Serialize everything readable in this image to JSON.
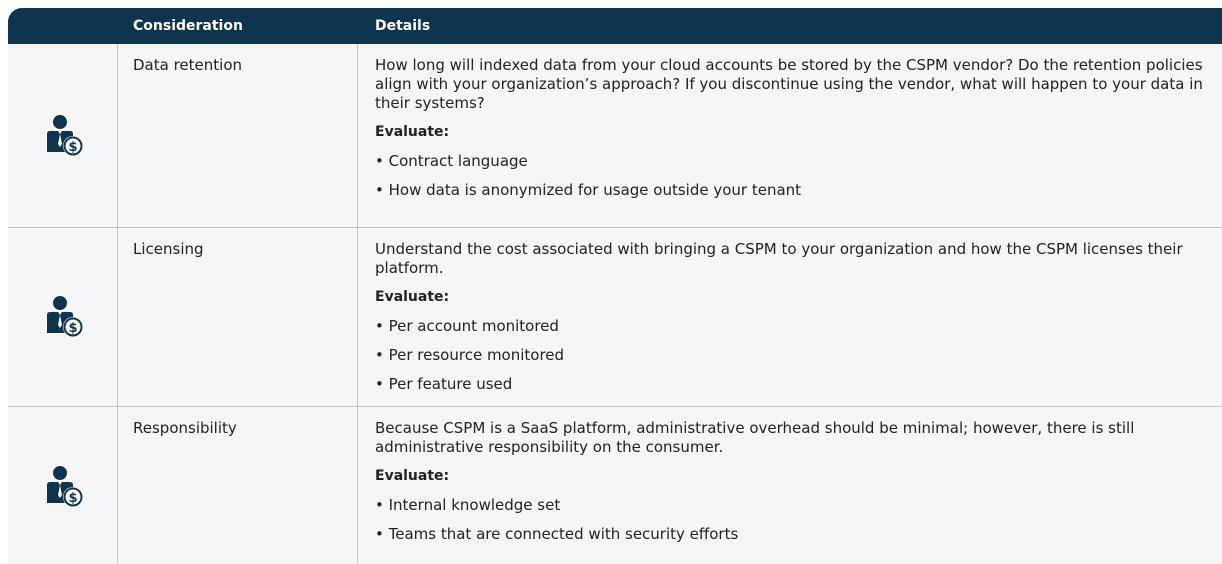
{
  "header": {
    "consideration": "Consideration",
    "details": "Details"
  },
  "rows": [
    {
      "consideration": "Data retention",
      "description": "How long will indexed data from your cloud accounts be stored by the CSPM vendor? Do the retention policies align with your organization’s approach? If you discontinue using the vendor, what will happen to your data in their systems?",
      "evaluate_label": "Evaluate:",
      "bullets": [
        "Contract language",
        "How data is anonymized for usage outside your tenant"
      ],
      "icon": "person-dollar-icon"
    },
    {
      "consideration": "Licensing",
      "description": "Understand the cost associated with bringing a CSPM to your organization and how the CSPM licenses their platform.",
      "evaluate_label": "Evaluate:",
      "bullets": [
        "Per account monitored",
        "Per resource monitored",
        "Per feature used"
      ],
      "icon": "person-dollar-icon"
    },
    {
      "consideration": "Responsibility",
      "description": "Because CSPM is a SaaS platform, administrative overhead should be minimal; however, there is still administrative responsibility on the consumer.",
      "evaluate_label": "Evaluate:",
      "bullets": [
        "Internal knowledge set",
        "Teams that are connected with security efforts"
      ],
      "icon": "person-dollar-icon"
    }
  ],
  "colors": {
    "header_bg": "#0d3550",
    "icon": "#0d3550",
    "row_bg": "#f4f5f7"
  }
}
